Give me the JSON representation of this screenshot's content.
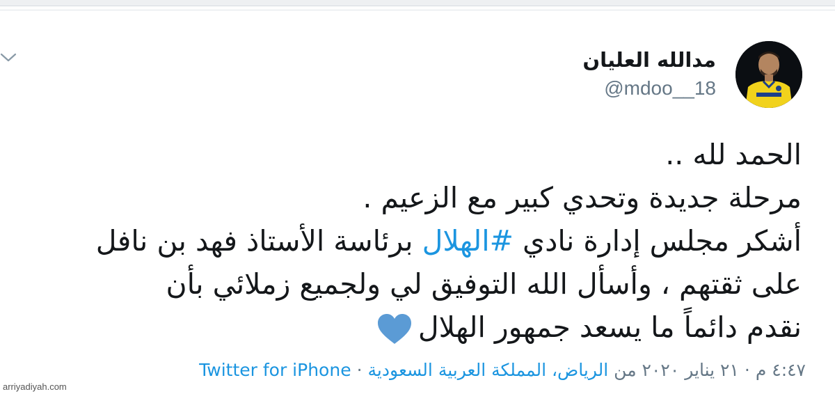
{
  "tweet": {
    "author": {
      "name": "مدالله العليان",
      "handle": "@mdoo__18",
      "avatar_icon": "player-avatar"
    },
    "lines": [
      {
        "text": "الحمد لله .."
      },
      {
        "text": "مرحلة جديدة وتحدي كبير مع الزعيم ."
      },
      {
        "before": "أشكر مجلس إدارة نادي ",
        "hashtag": "#الهلال",
        "after": " برئاسة الأستاذ فهد بن نافل"
      },
      {
        "text": "على ثقتهم ، وأسأل الله التوفيق لي ولجميع زملائي بأن"
      },
      {
        "text": "نقدم دائماً ما يسعد جمهور الهلال",
        "icon": "blue-heart-icon"
      }
    ],
    "meta": {
      "time": "٤:٤٧ م",
      "date": "٢١ يناير ٢٠٢٠",
      "location_prefix": "من",
      "location": "الرياض، المملكة العربية السعودية",
      "source": "Twitter for iPhone"
    },
    "colors": {
      "hashtag": "#1b95e0",
      "heart": "#5b9bd5",
      "text": "#14171a",
      "muted": "#657786"
    }
  },
  "watermark": "arriyadiyah.com"
}
